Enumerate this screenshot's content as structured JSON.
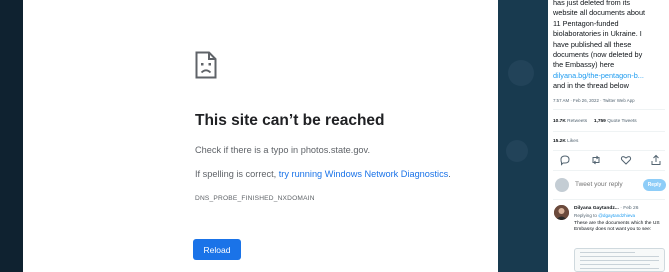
{
  "error_page": {
    "title": "This site can’t be reached",
    "typo_text": "Check if there is a typo in photos.state.gov.",
    "spelling_prefix": "If spelling is correct, ",
    "spelling_link": "try running Windows Network Diagnostics",
    "spelling_suffix": ".",
    "error_code": "DNS_PROBE_FINISHED_NXDOMAIN",
    "reload_label": "Reload",
    "icon": "sad-page-icon"
  },
  "tweet": {
    "lines": [
      "has just deleted from its",
      "website all documents about",
      "11 Pentagon-funded",
      "biolaboratories in Ukraine. I",
      "have published all these",
      "documents (now deleted by",
      "the Embassy) here"
    ],
    "link": "dilyana.bg/the-pentagon-b...",
    "after_link": "and in the thread below",
    "meta": "7:57 AM · Feb 26, 2022 · Twitter Web App",
    "retweets_count": "10.7K",
    "retweets_label": "Retweets",
    "quotes_count": "1,759",
    "quotes_label": "Quote Tweets",
    "likes_count": "15.2K",
    "likes_label": "Likes",
    "reply_placeholder": "Tweet your reply",
    "reply_button": "Reply"
  },
  "reply_tweet": {
    "author": "Dilyana Gaytandz...",
    "date": "· Feb 26",
    "replying_prefix": "Replying to ",
    "replying_handle": "@dgaytandzhieva",
    "body": "These are the documents which the US Embassy does not want you to see:"
  },
  "colors": {
    "link_blue": "#1a73e8",
    "twitter_blue": "#1d9bf0",
    "background": "#16384e"
  }
}
